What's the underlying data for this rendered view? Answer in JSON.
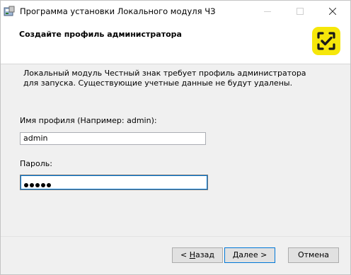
{
  "window": {
    "title": "Программа установки Локального модуля ЧЗ",
    "colors": {
      "accent": "#0078d7",
      "logo_bg": "#f6e70a",
      "logo_fg": "#1a1a1a"
    }
  },
  "header": {
    "title": "Создайте профиль администратора",
    "logo_icon": "chestny-znak-logo"
  },
  "body": {
    "description": "Локальный модуль Честный знак требует профиль администратора для запуска. Существующие учетные данные не будут удалены.",
    "profile_label": "Имя профиля (Например: admin):",
    "profile_value": "admin",
    "password_label": "Пароль:",
    "password_mask": "•••••"
  },
  "buttons": {
    "back_label_mnemonic": "Н",
    "back_label_rest": "азад",
    "back_prefix": "< ",
    "next_label_mnemonic": "Д",
    "next_label_rest": "алее >",
    "cancel_label": "Отмена"
  }
}
